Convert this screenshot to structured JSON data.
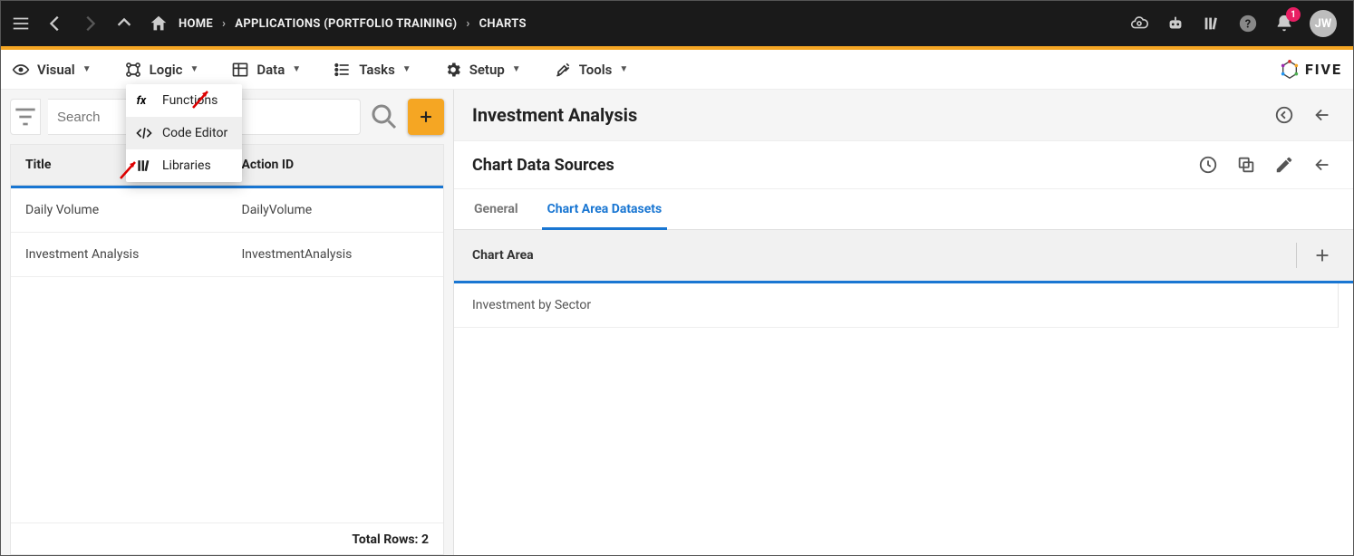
{
  "topbar": {
    "home_label": "HOME",
    "crumb_app": "APPLICATIONS (PORTFOLIO TRAINING)",
    "crumb_charts": "CHARTS",
    "avatar_initials": "JW",
    "notification_count": "1"
  },
  "menubar": {
    "visual": "Visual",
    "logic": "Logic",
    "data": "Data",
    "tasks": "Tasks",
    "setup": "Setup",
    "tools": "Tools",
    "brand": "FIVE"
  },
  "logic_menu": {
    "functions": "Functions",
    "code_editor": "Code Editor",
    "libraries": "Libraries"
  },
  "search": {
    "placeholder": "Search"
  },
  "table": {
    "col_title": "Title",
    "col_action": "Action ID",
    "rows": [
      {
        "title": "Daily Volume",
        "action": "DailyVolume"
      },
      {
        "title": "Investment Analysis",
        "action": "InvestmentAnalysis"
      }
    ],
    "footer": "Total Rows: 2"
  },
  "right": {
    "title": "Investment Analysis",
    "subtitle": "Chart Data Sources",
    "tab_general": "General",
    "tab_datasets": "Chart Area Datasets",
    "section_label": "Chart Area",
    "items": [
      "Investment by Sector"
    ]
  }
}
